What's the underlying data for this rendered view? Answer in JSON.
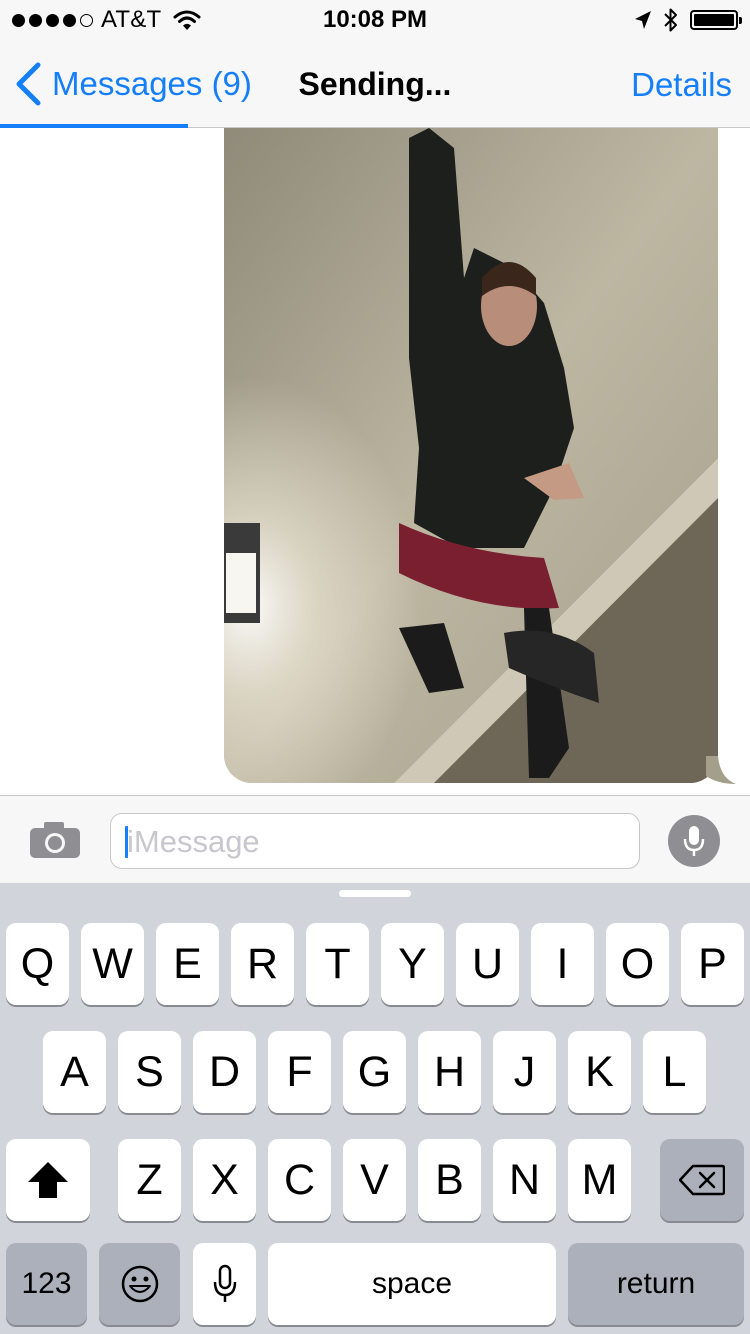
{
  "status_bar": {
    "signal_dots_filled": 4,
    "signal_dots_total": 5,
    "carrier": "AT&T",
    "time": "10:08 PM",
    "icons": [
      "wifi-icon",
      "location-arrow-icon",
      "bluetooth-icon",
      "battery-icon"
    ],
    "battery_level": 1.0
  },
  "nav": {
    "back_label": "Messages (9)",
    "title": "Sending...",
    "details_label": "Details",
    "send_progress": 0.25
  },
  "conversation": {
    "messages": [
      {
        "type": "photo",
        "sender": "me",
        "description_icon": "photo-attachment"
      }
    ]
  },
  "input_bar": {
    "placeholder": "iMessage",
    "value": "",
    "icons": [
      "camera-icon",
      "microphone-icon"
    ]
  },
  "keyboard": {
    "row1": [
      "Q",
      "W",
      "E",
      "R",
      "T",
      "Y",
      "U",
      "I",
      "O",
      "P"
    ],
    "row2": [
      "A",
      "S",
      "D",
      "F",
      "G",
      "H",
      "J",
      "K",
      "L"
    ],
    "row3": [
      "Z",
      "X",
      "C",
      "V",
      "B",
      "N",
      "M"
    ],
    "numbers_label": "123",
    "space_label": "space",
    "return_label": "return"
  },
  "colors": {
    "accent": "#147efb",
    "bar_background": "#f7f7f7",
    "keyboard_background": "#d1d5db",
    "dark_key": "#abb0ba"
  }
}
